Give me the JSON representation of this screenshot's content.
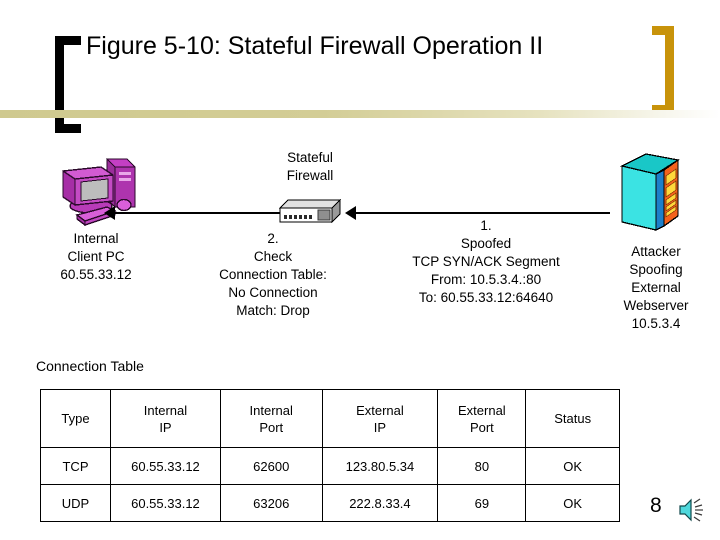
{
  "slide": {
    "title": "Figure 5-10: Stateful Firewall Operation II",
    "page_number": "8"
  },
  "theme": {
    "bracket_left_color": "#000000",
    "bracket_right_color": "#C8930A",
    "divider_color": "#CFC98F",
    "pc_color": "#CC44CC",
    "server_color": "#3BE3E3",
    "server_panel_color": "#F4621C",
    "speaker_color": "#4FD8DC"
  },
  "diagram": {
    "firewall_label": "Stateful\nFirewall",
    "firewall_label_lines": [
      "Stateful",
      "Firewall"
    ],
    "pc_label_lines": [
      "Internal",
      "Client PC",
      "60.55.33.12"
    ],
    "step2_label_lines": [
      "2.",
      "Check",
      "Connection Table:",
      "No Connection",
      "Match: Drop"
    ],
    "step1_label_lines": [
      "1.",
      "Spoofed",
      "TCP SYN/ACK Segment",
      "From: 10.5.3.4.:80",
      "To: 60.55.33.12:64640"
    ],
    "attacker_label_lines": [
      "Attacker",
      "Spoofing",
      "External",
      "Webserver",
      "10.5.3.4"
    ],
    "icons": {
      "pc": "computer-pc-icon",
      "firewall": "firewall-appliance-icon",
      "server": "server-rack-icon",
      "arrow_left": "arrow-left-icon",
      "arrow_right": "arrow-left-icon"
    }
  },
  "connection_table": {
    "title": "Connection Table",
    "headers": [
      [
        "Type"
      ],
      [
        "Internal",
        "IP"
      ],
      [
        "Internal",
        "Port"
      ],
      [
        "External",
        "IP"
      ],
      [
        "External",
        "Port"
      ],
      [
        "Status"
      ]
    ],
    "rows": [
      {
        "type": "TCP",
        "internal_ip": "60.55.33.12",
        "internal_port": "62600",
        "external_ip": "123.80.5.34",
        "external_port": "80",
        "status": "OK"
      },
      {
        "type": "UDP",
        "internal_ip": "60.55.33.12",
        "internal_port": "63206",
        "external_ip": "222.8.33.4",
        "external_port": "69",
        "status": "OK"
      }
    ]
  }
}
